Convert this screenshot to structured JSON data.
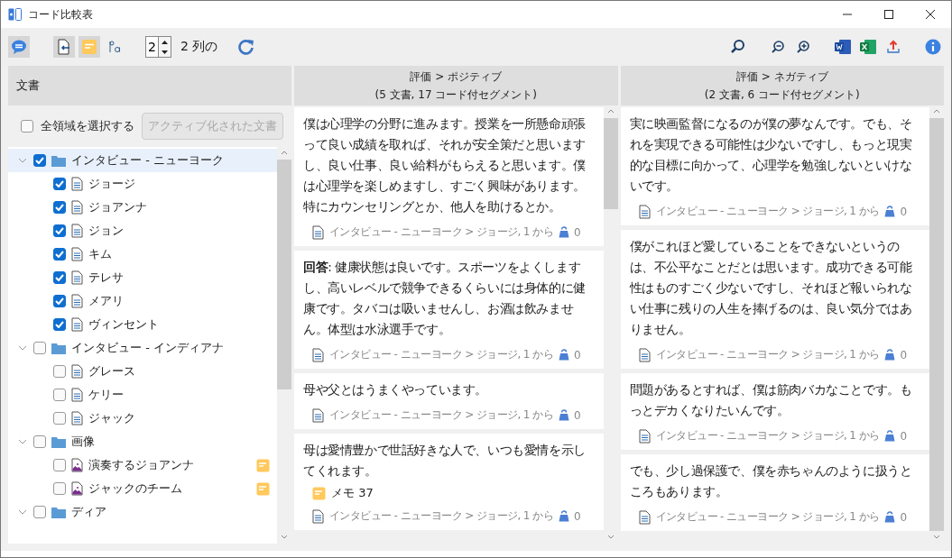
{
  "window": {
    "title": "コード比較表"
  },
  "toolbar": {
    "columns_value": "2",
    "columns_label": "2 列の"
  },
  "sidebar": {
    "title": "文書",
    "select_all": {
      "label": "全領域を選択する",
      "checked": false
    },
    "activate_button": {
      "label": "アクティブ化された文書",
      "disabled": true
    },
    "tree": [
      {
        "kind": "folder",
        "label": "インタビュー - ニューヨーク",
        "checked": true,
        "selected": true,
        "expanded": true,
        "has_memo": false,
        "children": [
          {
            "kind": "text",
            "label": "ジョージ",
            "checked": true,
            "selected": false,
            "has_memo": false
          },
          {
            "kind": "text",
            "label": "ジョアンナ",
            "checked": true,
            "selected": false,
            "has_memo": false
          },
          {
            "kind": "text",
            "label": "ジョン",
            "checked": true,
            "selected": false,
            "has_memo": false
          },
          {
            "kind": "text",
            "label": "キム",
            "checked": true,
            "selected": false,
            "has_memo": false
          },
          {
            "kind": "text",
            "label": "テレサ",
            "checked": true,
            "selected": false,
            "has_memo": false
          },
          {
            "kind": "text",
            "label": "メアリ",
            "checked": true,
            "selected": false,
            "has_memo": false
          },
          {
            "kind": "text",
            "label": "ヴィンセント",
            "checked": true,
            "selected": false,
            "has_memo": false
          }
        ]
      },
      {
        "kind": "folder",
        "label": "インタビュー - インディアナ",
        "checked": false,
        "selected": false,
        "expanded": true,
        "has_memo": false,
        "children": [
          {
            "kind": "text",
            "label": "グレース",
            "checked": false,
            "selected": false,
            "has_memo": false
          },
          {
            "kind": "text",
            "label": "ケリー",
            "checked": false,
            "selected": false,
            "has_memo": false
          },
          {
            "kind": "text",
            "label": "ジャック",
            "checked": false,
            "selected": false,
            "has_memo": false
          }
        ]
      },
      {
        "kind": "folder",
        "label": "画像",
        "checked": false,
        "selected": false,
        "expanded": true,
        "has_memo": false,
        "children": [
          {
            "kind": "image",
            "label": "演奏するジョアンナ",
            "checked": false,
            "selected": false,
            "has_memo": true
          },
          {
            "kind": "image",
            "label": "ジャックのチーム",
            "checked": false,
            "selected": false,
            "has_memo": true
          }
        ]
      },
      {
        "kind": "folder",
        "label": "ディア",
        "checked": false,
        "selected": false,
        "expanded": true,
        "has_memo": false
      }
    ]
  },
  "columns": [
    {
      "title": "評価 > ポジティブ",
      "subtitle": "(5 文書, 17 コード付セグメント)",
      "cards": [
        {
          "text": "僕は心理学の分野に進みます。授業を一所懸命頑張って良い成績を取れば、それが安全策だと思いますし、良い仕事、良い給料がもらえると思います。僕は心理学を楽しめますし、すごく興味があります。特にカウンセリングとか、他人を助けるとか。",
          "source": "インタビュー - ニューヨーク > ジョージ, 1 から",
          "weight": "0"
        },
        {
          "text": "**回答**: 健康状態は良いです。スポーツをよくしますし、高いレベルで競争できるくらいには身体的に健康です。タバコは吸いませんし、お酒は飲みません。体型は水泳選手です。",
          "source": "インタビュー - ニューヨーク > ジョージ, 1 から",
          "weight": "0"
        },
        {
          "text": "母や父とはうまくやっています。",
          "source": "インタビュー - ニューヨーク > ジョージ, 1 から",
          "weight": "0"
        },
        {
          "text": "母は愛情豊かで世話好きな人で、いつも愛情を示してくれます。",
          "memo": "メモ 37",
          "source": "インタビュー - ニューヨーク > ジョージ, 1 から",
          "weight": "0"
        }
      ]
    },
    {
      "title": "評価 > ネガティブ",
      "subtitle": "(2 文書, 6 コード付セグメント)",
      "cards": [
        {
          "text": "実に映画監督になるのが僕の夢なんです。でも、それを実現できる可能性は少ないですし、もっと現実的な目標に向かって、心理学を勉強しないといけないです。",
          "source": "インタビュー - ニューヨーク > ジョージ, 1 から",
          "weight": "0"
        },
        {
          "text": "僕がこれほど愛していることをできないというのは、不公平なことだとは思います。成功できる可能性はものすごく少ないですし、それほど報いられない仕事に残りの人生を捧げるのは、良い気分ではありません。",
          "source": "インタビュー - ニューヨーク > ジョージ, 1 から",
          "weight": "0"
        },
        {
          "text": "問題があるとすれば、僕は筋肉バカなことです。もっとデカくなりたいんです。",
          "source": "インタビュー - ニューヨーク > ジョージ, 1 から",
          "weight": "0"
        },
        {
          "text": "でも、少し過保護で、僕を赤ちゃんのように扱うところもあります。",
          "source": "インタビュー - ニューヨーク > ジョージ, 1 から",
          "weight": "0"
        }
      ]
    }
  ]
}
